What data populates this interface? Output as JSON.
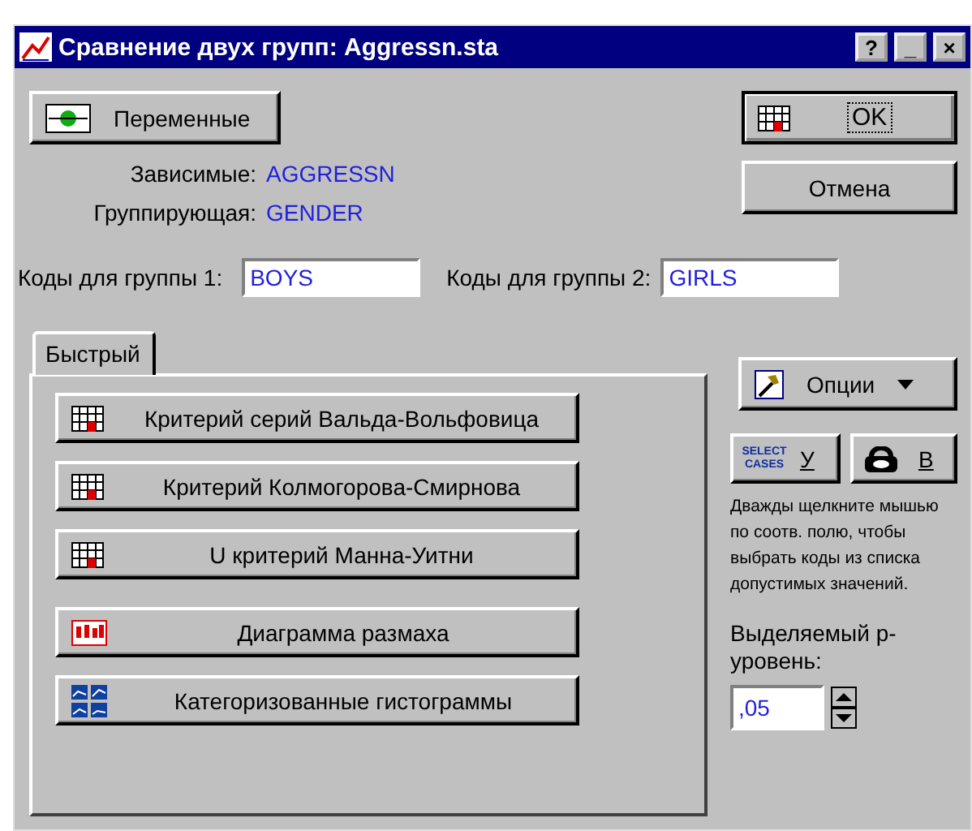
{
  "window": {
    "title": "Сравнение двух групп: Aggressn.sta",
    "controls": [
      "?",
      "_",
      "×"
    ]
  },
  "variables_button": {
    "label": "Переменные"
  },
  "variables": [
    {
      "label": "Зависимые:",
      "value": "AGGRESSN"
    },
    {
      "label": "Группирующая:",
      "value": "GENDER"
    }
  ],
  "ok_button": {
    "label": "OK"
  },
  "cancel_button": {
    "label": "Отмена"
  },
  "codes": [
    {
      "label": "Коды для группы 1:",
      "value": "BOYS"
    },
    {
      "label": "Коды для группы 2:",
      "value": "GIRLS"
    }
  ],
  "tabs": [
    {
      "label": "Быстрый",
      "selected": true
    }
  ],
  "tests": [
    {
      "label": "Критерий серий Вальда-Вольфовица",
      "kind": "table"
    },
    {
      "label": "Критерий Колмогорова-Смирнова",
      "kind": "table"
    },
    {
      "label": "U критерий Манна-Уитни",
      "kind": "table"
    },
    {
      "label": "Диаграмма размаха",
      "kind": "boxplot"
    },
    {
      "label": "Категоризованные гистограммы",
      "kind": "histograms"
    }
  ],
  "options_button": {
    "label": "Опции"
  },
  "select_cases_button": {
    "icon_text": "SELECT CASES",
    "label": "У"
  },
  "weights_button": {
    "label": "В"
  },
  "help_text": "Дважды щелкните мышью по соотв. полю, чтобы выбрать коды из списка допустимых значений.",
  "p_level": {
    "label": "Выделяемый р-уровень:",
    "value": ",05"
  }
}
